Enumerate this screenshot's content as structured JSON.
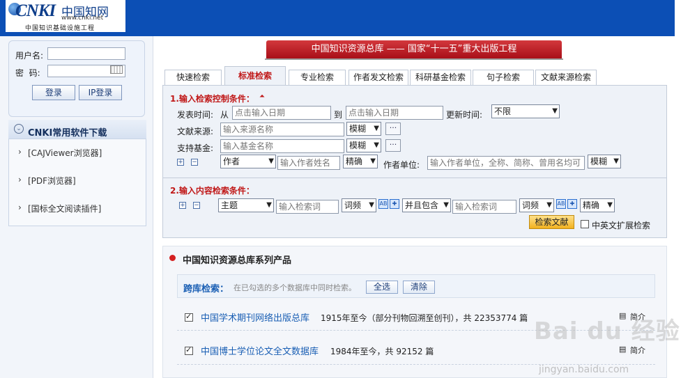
{
  "header": {
    "logo_mark": "CNKI",
    "logo_cn": "中国知网",
    "logo_url": "www.cnki.net",
    "slogan": "中国知识基础设施工程",
    "bg_color": "#0c4fb5"
  },
  "login": {
    "username_label": "用户名:",
    "password_label": "密  码:",
    "login_btn": "登录",
    "ip_login_btn": "IP登录"
  },
  "software": {
    "title": "CNKI常用软件下载",
    "items": [
      "[CAJViewer浏览器]",
      "[PDF浏览器]",
      "[国标全文阅读插件]"
    ]
  },
  "banner": "中国知识资源总库 —— 国家“十一五”重大出版工程",
  "tabs": [
    "快速检索",
    "标准检索",
    "专业检索",
    "作者发文检索",
    "科研基金检索",
    "句子检索",
    "文献来源检索"
  ],
  "active_tab": "标准检索",
  "control": {
    "title": "1.输入检索控制条件：",
    "pub_time_label": "发表时间:",
    "from": "从",
    "to": "到",
    "date_placeholder": "点击输入日期",
    "update_label": "更新时间:",
    "update_value": "不限",
    "source_label": "文献来源:",
    "source_placeholder": "输入来源名称",
    "fund_label": "支持基金:",
    "fund_placeholder": "输入基金名称",
    "fuzzy": "模糊",
    "exact": "精确",
    "author_field": "作者",
    "author_placeholder": "输入作者姓名",
    "unit_label": "作者单位:",
    "unit_placeholder": "输入作者单位，全称、简称、曾用名均可",
    "unit_match": "模糊",
    "more": "···"
  },
  "content": {
    "title": "2.输入内容检索条件：",
    "field": "主题",
    "placeholder": "输入检索词",
    "freq": "词频",
    "logic": "并且包含",
    "match": "精确",
    "search_btn": "检索文献",
    "cn_en_label": "中英文扩展检索"
  },
  "products": {
    "title": "中国知识资源总库系列产品",
    "cross_label": "跨库检索：",
    "cross_hint": "在已勾选的多个数据库中同时检索。",
    "select_all": "全选",
    "clear": "清除",
    "databases": [
      {
        "name": "中国学术期刊网络出版总库",
        "desc": "1915年至今（部分刊物回溯至创刊），共 22353774 篇",
        "checked": true
      },
      {
        "name": "中国博士学位论文全文数据库",
        "desc": "1984年至今，共 92152 篇",
        "checked": true
      }
    ],
    "intro": "简介"
  },
  "watermark": {
    "main": "Bai du 经验",
    "sub": "jingyan.baidu.com"
  }
}
